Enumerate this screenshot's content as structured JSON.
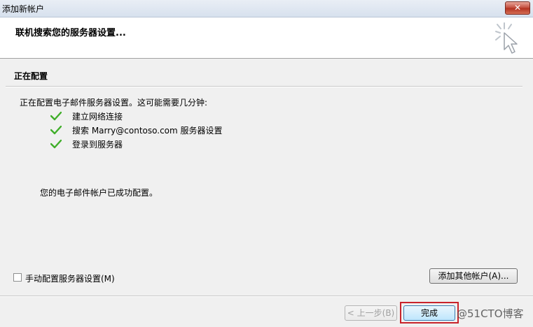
{
  "window": {
    "title": "添加新帐户",
    "close_label": "✕"
  },
  "header": {
    "title": "联机搜索您的服务器设置..."
  },
  "section": {
    "heading": "正在配置"
  },
  "status": {
    "intro": "正在配置电子邮件服务器设置。这可能需要几分钟:",
    "steps": [
      {
        "label": "建立网络连接",
        "done": true
      },
      {
        "label": "搜索 Marry@contoso.com 服务器设置",
        "done": true
      },
      {
        "label": "登录到服务器",
        "done": true
      }
    ],
    "success": "您的电子邮件帐户已成功配置。"
  },
  "options": {
    "manual_config_label": "手动配置服务器设置(M)",
    "manual_config_checked": false,
    "add_other_label": "添加其他帐户(A)..."
  },
  "footer": {
    "back_label": "< 上一步(B)",
    "finish_label": "完成"
  },
  "watermark": "@51CTO博客",
  "colors": {
    "check": "#3fae29",
    "highlight": "#c8232b"
  }
}
